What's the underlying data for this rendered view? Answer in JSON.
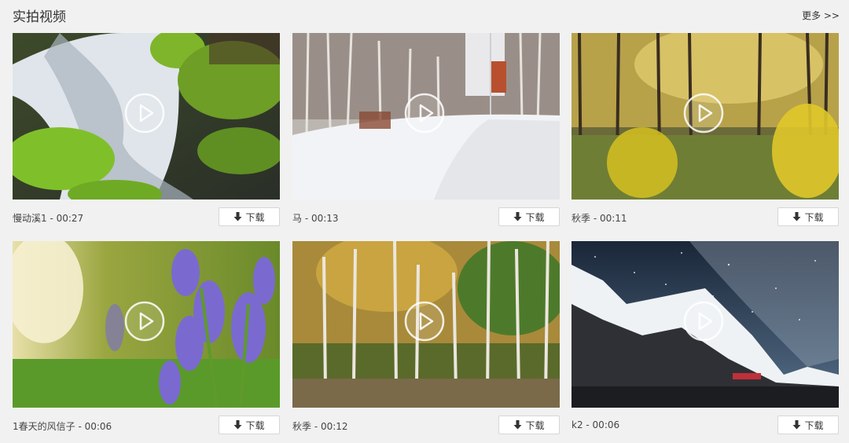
{
  "header": {
    "title": "实拍视频",
    "more_label": "更多 >>"
  },
  "download_label": "下载",
  "videos": [
    {
      "caption": "慢动溪1 - 00:27",
      "scene": "stream-moss"
    },
    {
      "caption": "马 - 00:13",
      "scene": "snowy-birch-road"
    },
    {
      "caption": "秋季 - 00:11",
      "scene": "autumn-forest"
    },
    {
      "caption": "1春天的风信子 - 00:06",
      "scene": "bluebells"
    },
    {
      "caption": "秋季 - 00:12",
      "scene": "autumn-birches"
    },
    {
      "caption": "k2 - 00:06",
      "scene": "starry-mountain"
    }
  ]
}
